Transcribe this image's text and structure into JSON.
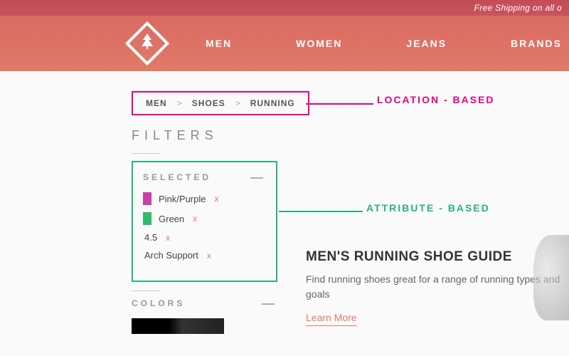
{
  "promo": {
    "text": "Free Shipping on all o"
  },
  "nav": {
    "items": [
      "MEN",
      "WOMEN",
      "JEANS",
      "BRANDS"
    ]
  },
  "breadcrumb": {
    "items": [
      "MEN",
      "SHOES",
      "RUNNING"
    ],
    "sep": ">"
  },
  "annotations": {
    "location": "LOCATION - BASED",
    "attribute": "ATTRIBUTE - BASED"
  },
  "filters": {
    "title": "FILTERS",
    "selected_label": "SELECTED",
    "collapse_glyph": "—",
    "items": [
      {
        "label": "Pink/Purple",
        "swatch": "#c93fa6",
        "remove": "x"
      },
      {
        "label": "Green",
        "swatch": "#2fbb6a",
        "remove": "x"
      },
      {
        "label": "4.5",
        "swatch": null,
        "remove": "x"
      },
      {
        "label": "Arch Support",
        "swatch": null,
        "remove": "x"
      }
    ],
    "colors_label": "COLORS"
  },
  "guide": {
    "title": "MEN'S RUNNING SHOE GUIDE",
    "desc": "Find running shoes great for\na range of running types and goals",
    "learn": "Learn More"
  }
}
